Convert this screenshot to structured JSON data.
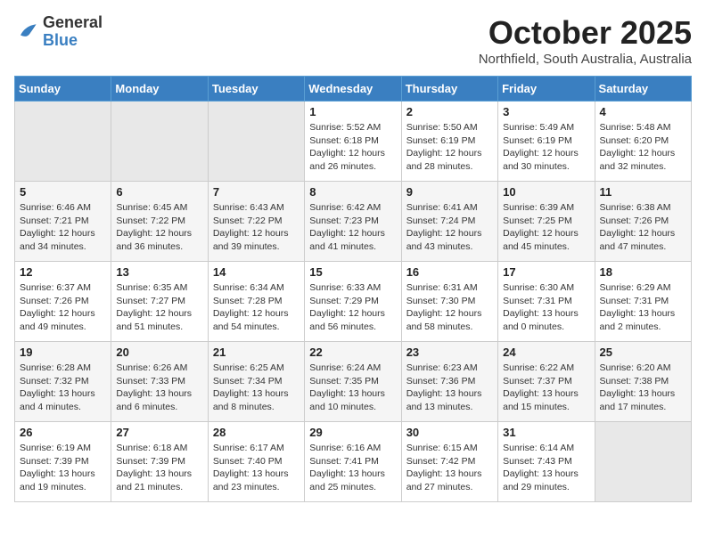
{
  "header": {
    "logo": {
      "general": "General",
      "blue": "Blue"
    },
    "title": "October 2025",
    "location": "Northfield, South Australia, Australia"
  },
  "weekdays": [
    "Sunday",
    "Monday",
    "Tuesday",
    "Wednesday",
    "Thursday",
    "Friday",
    "Saturday"
  ],
  "weeks": [
    [
      {
        "day": "",
        "info": ""
      },
      {
        "day": "",
        "info": ""
      },
      {
        "day": "",
        "info": ""
      },
      {
        "day": "1",
        "info": "Sunrise: 5:52 AM\nSunset: 6:18 PM\nDaylight: 12 hours\nand 26 minutes."
      },
      {
        "day": "2",
        "info": "Sunrise: 5:50 AM\nSunset: 6:19 PM\nDaylight: 12 hours\nand 28 minutes."
      },
      {
        "day": "3",
        "info": "Sunrise: 5:49 AM\nSunset: 6:19 PM\nDaylight: 12 hours\nand 30 minutes."
      },
      {
        "day": "4",
        "info": "Sunrise: 5:48 AM\nSunset: 6:20 PM\nDaylight: 12 hours\nand 32 minutes."
      }
    ],
    [
      {
        "day": "5",
        "info": "Sunrise: 6:46 AM\nSunset: 7:21 PM\nDaylight: 12 hours\nand 34 minutes."
      },
      {
        "day": "6",
        "info": "Sunrise: 6:45 AM\nSunset: 7:22 PM\nDaylight: 12 hours\nand 36 minutes."
      },
      {
        "day": "7",
        "info": "Sunrise: 6:43 AM\nSunset: 7:22 PM\nDaylight: 12 hours\nand 39 minutes."
      },
      {
        "day": "8",
        "info": "Sunrise: 6:42 AM\nSunset: 7:23 PM\nDaylight: 12 hours\nand 41 minutes."
      },
      {
        "day": "9",
        "info": "Sunrise: 6:41 AM\nSunset: 7:24 PM\nDaylight: 12 hours\nand 43 minutes."
      },
      {
        "day": "10",
        "info": "Sunrise: 6:39 AM\nSunset: 7:25 PM\nDaylight: 12 hours\nand 45 minutes."
      },
      {
        "day": "11",
        "info": "Sunrise: 6:38 AM\nSunset: 7:26 PM\nDaylight: 12 hours\nand 47 minutes."
      }
    ],
    [
      {
        "day": "12",
        "info": "Sunrise: 6:37 AM\nSunset: 7:26 PM\nDaylight: 12 hours\nand 49 minutes."
      },
      {
        "day": "13",
        "info": "Sunrise: 6:35 AM\nSunset: 7:27 PM\nDaylight: 12 hours\nand 51 minutes."
      },
      {
        "day": "14",
        "info": "Sunrise: 6:34 AM\nSunset: 7:28 PM\nDaylight: 12 hours\nand 54 minutes."
      },
      {
        "day": "15",
        "info": "Sunrise: 6:33 AM\nSunset: 7:29 PM\nDaylight: 12 hours\nand 56 minutes."
      },
      {
        "day": "16",
        "info": "Sunrise: 6:31 AM\nSunset: 7:30 PM\nDaylight: 12 hours\nand 58 minutes."
      },
      {
        "day": "17",
        "info": "Sunrise: 6:30 AM\nSunset: 7:31 PM\nDaylight: 13 hours\nand 0 minutes."
      },
      {
        "day": "18",
        "info": "Sunrise: 6:29 AM\nSunset: 7:31 PM\nDaylight: 13 hours\nand 2 minutes."
      }
    ],
    [
      {
        "day": "19",
        "info": "Sunrise: 6:28 AM\nSunset: 7:32 PM\nDaylight: 13 hours\nand 4 minutes."
      },
      {
        "day": "20",
        "info": "Sunrise: 6:26 AM\nSunset: 7:33 PM\nDaylight: 13 hours\nand 6 minutes."
      },
      {
        "day": "21",
        "info": "Sunrise: 6:25 AM\nSunset: 7:34 PM\nDaylight: 13 hours\nand 8 minutes."
      },
      {
        "day": "22",
        "info": "Sunrise: 6:24 AM\nSunset: 7:35 PM\nDaylight: 13 hours\nand 10 minutes."
      },
      {
        "day": "23",
        "info": "Sunrise: 6:23 AM\nSunset: 7:36 PM\nDaylight: 13 hours\nand 13 minutes."
      },
      {
        "day": "24",
        "info": "Sunrise: 6:22 AM\nSunset: 7:37 PM\nDaylight: 13 hours\nand 15 minutes."
      },
      {
        "day": "25",
        "info": "Sunrise: 6:20 AM\nSunset: 7:38 PM\nDaylight: 13 hours\nand 17 minutes."
      }
    ],
    [
      {
        "day": "26",
        "info": "Sunrise: 6:19 AM\nSunset: 7:39 PM\nDaylight: 13 hours\nand 19 minutes."
      },
      {
        "day": "27",
        "info": "Sunrise: 6:18 AM\nSunset: 7:39 PM\nDaylight: 13 hours\nand 21 minutes."
      },
      {
        "day": "28",
        "info": "Sunrise: 6:17 AM\nSunset: 7:40 PM\nDaylight: 13 hours\nand 23 minutes."
      },
      {
        "day": "29",
        "info": "Sunrise: 6:16 AM\nSunset: 7:41 PM\nDaylight: 13 hours\nand 25 minutes."
      },
      {
        "day": "30",
        "info": "Sunrise: 6:15 AM\nSunset: 7:42 PM\nDaylight: 13 hours\nand 27 minutes."
      },
      {
        "day": "31",
        "info": "Sunrise: 6:14 AM\nSunset: 7:43 PM\nDaylight: 13 hours\nand 29 minutes."
      },
      {
        "day": "",
        "info": ""
      }
    ]
  ]
}
